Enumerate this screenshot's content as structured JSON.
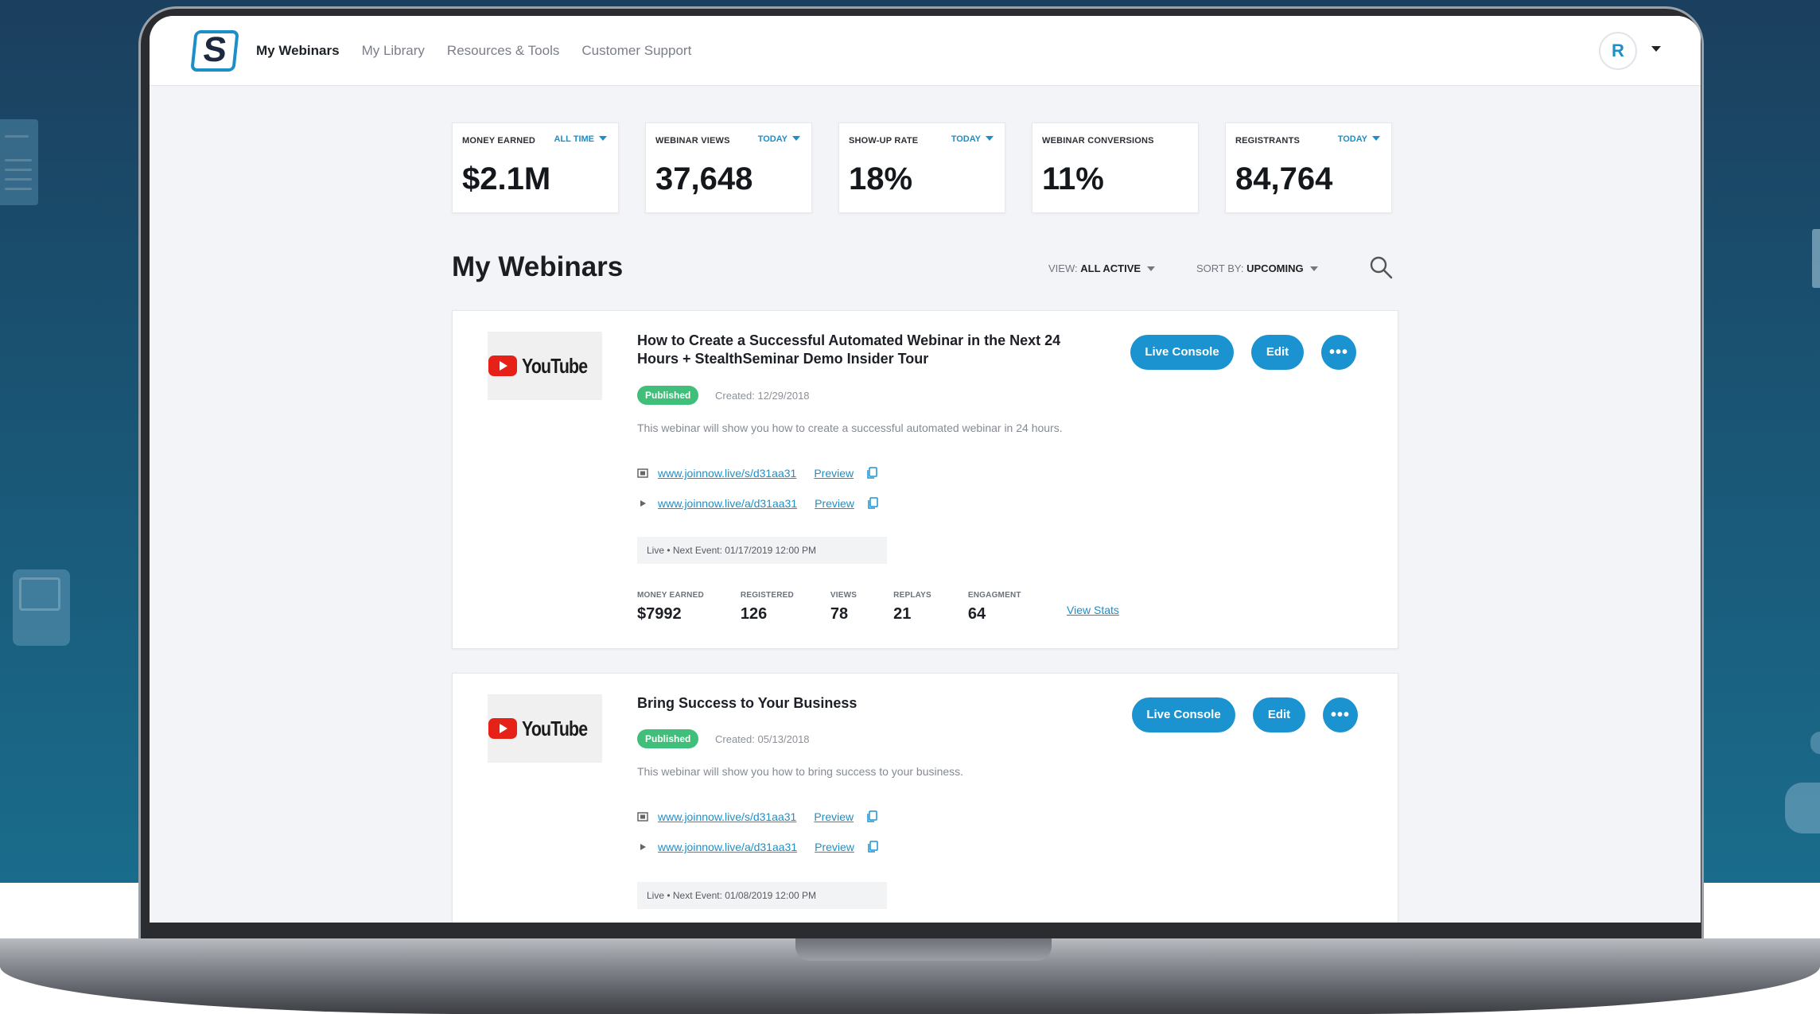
{
  "nav": {
    "items": [
      "My Webinars",
      "My Library",
      "Resources & Tools",
      "Customer Support"
    ],
    "active_index": 0
  },
  "user": {
    "avatar_initial": "R"
  },
  "stats": [
    {
      "label": "MONEY EARNED",
      "range": "ALL TIME",
      "value": "$2.1M"
    },
    {
      "label": "WEBINAR VIEWS",
      "range": "TODAY",
      "value": "37,648"
    },
    {
      "label": "SHOW-UP RATE",
      "range": "TODAY",
      "value": "18%"
    },
    {
      "label": "WEBINAR CONVERSIONS",
      "range": "",
      "value": "11%"
    },
    {
      "label": "REGISTRANTS",
      "range": "TODAY",
      "value": "84,764"
    }
  ],
  "main": {
    "title": "My Webinars",
    "view_label": "VIEW:",
    "view_value": "ALL ACTIVE",
    "sort_label": "SORT BY:",
    "sort_value": "UPCOMING"
  },
  "webinars": [
    {
      "thumbnail_text": "YouTube",
      "title": "How to Create a Successful Automated Webinar in the Next 24 Hours + StealthSeminar Demo Insider Tour",
      "status": "Published",
      "created": "Created: 12/29/2018",
      "description": "This webinar will show you how to create a successful automated webinar in 24 hours.",
      "links": [
        {
          "url": "www.joinnow.live/s/d31aa31",
          "preview": "Preview"
        },
        {
          "url": "www.joinnow.live/a/d31aa31",
          "preview": "Preview"
        }
      ],
      "event": "Live  •  Next Event: 01/17/2019 12:00 PM",
      "buttons": {
        "console": "Live Console",
        "edit": "Edit",
        "more": "•••"
      },
      "metrics": [
        {
          "label": "MONEY EARNED",
          "value": "$7992"
        },
        {
          "label": "REGISTERED",
          "value": "126"
        },
        {
          "label": "VIEWS",
          "value": "78"
        },
        {
          "label": "REPLAYS",
          "value": "21"
        },
        {
          "label": "ENGAGMENT",
          "value": "64"
        }
      ],
      "view_stats": "View Stats"
    },
    {
      "thumbnail_text": "YouTube",
      "title": "Bring Success to Your Business",
      "status": "Published",
      "created": "Created: 05/13/2018",
      "description": "This webinar will show you how to bring success to your business.",
      "links": [
        {
          "url": "www.joinnow.live/s/d31aa31",
          "preview": "Preview"
        },
        {
          "url": "www.joinnow.live/a/d31aa31",
          "preview": "Preview"
        }
      ],
      "event": "Live  •  Next Event: 01/08/2019 12:00 PM",
      "buttons": {
        "console": "Live Console",
        "edit": "Edit",
        "more": "•••"
      }
    }
  ],
  "colors": {
    "accent": "#1a93d0",
    "published": "#3fbf7a",
    "background": "#1a5878"
  }
}
